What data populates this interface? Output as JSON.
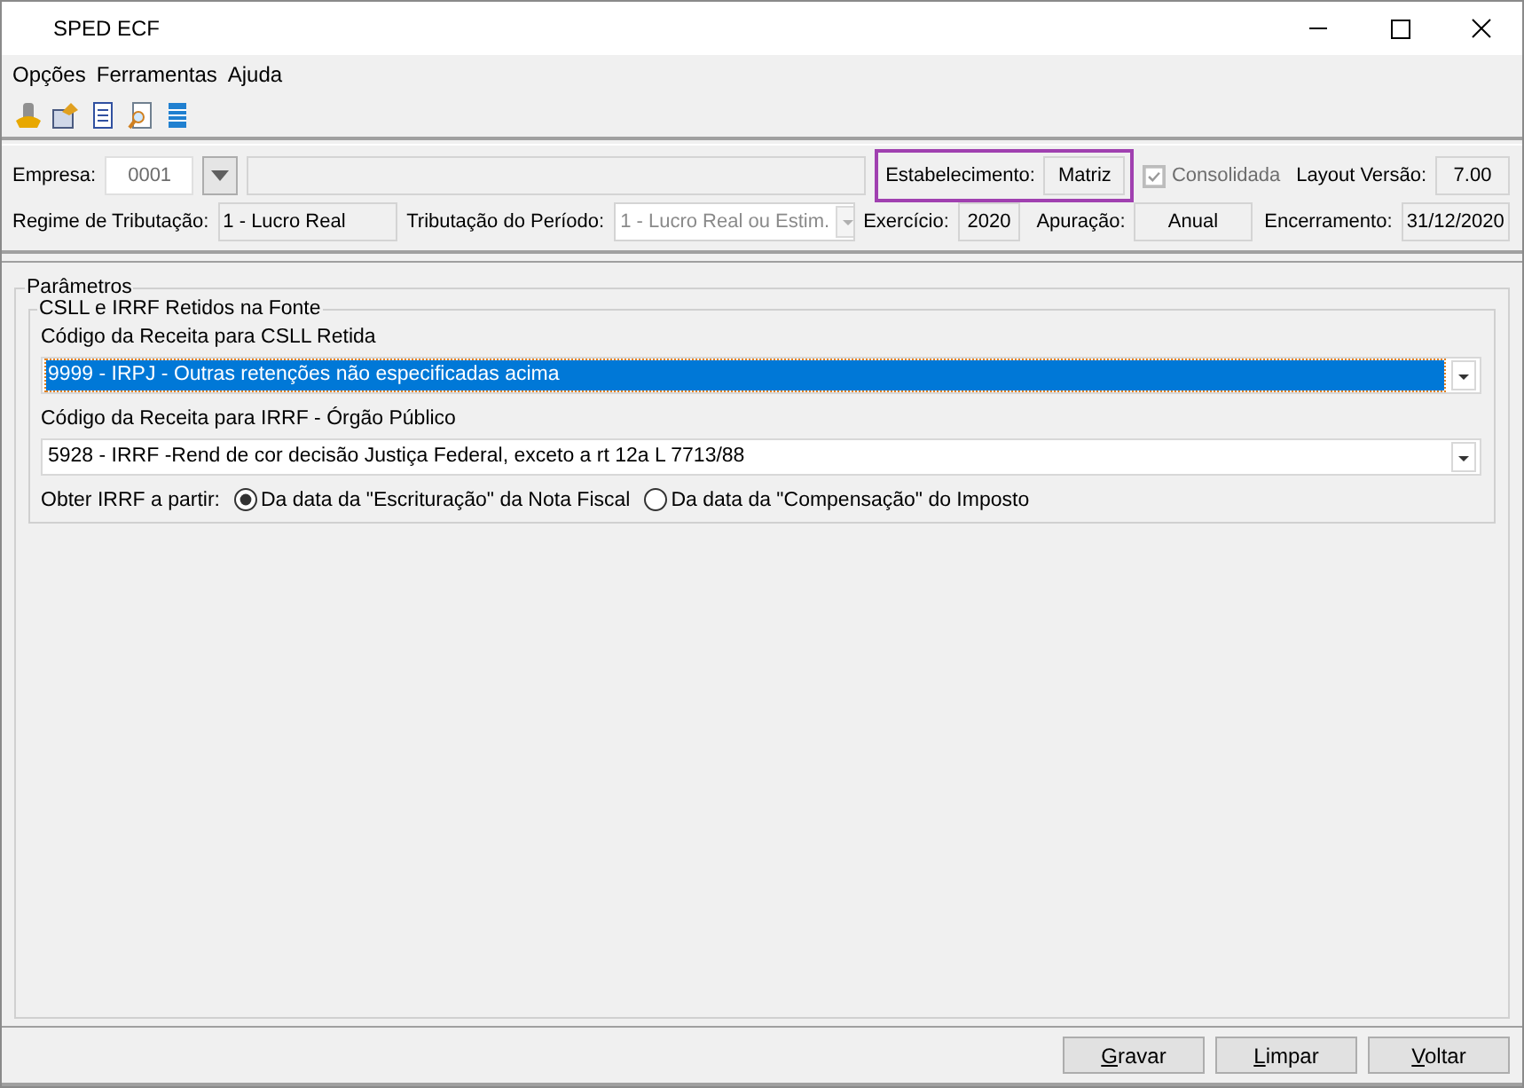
{
  "window": {
    "title": "SPED ECF"
  },
  "menu": [
    "Opções",
    "Ferramentas",
    "Ajuda"
  ],
  "header": {
    "empresa": {
      "label": "Empresa:",
      "value": "0001"
    },
    "estabelecimento": {
      "label": "Estabelecimento:",
      "value": "Matriz",
      "highlighted": true
    },
    "consolidada": {
      "label": "Consolidada",
      "checked": true,
      "disabled": true
    },
    "layout_versao": {
      "label": "Layout Versão:",
      "value": "7.00"
    },
    "regime": {
      "label": "Regime de Tributação:",
      "value": "1 - Lucro Real"
    },
    "tributacao": {
      "label": "Tributação do Período:",
      "value": "1 - Lucro Real ou Estim.",
      "disabled": true
    },
    "exercicio": {
      "label": "Exercício:",
      "value": "2020"
    },
    "apuracao": {
      "label": "Apuração:",
      "value": "Anual"
    },
    "encerramento": {
      "label": "Encerramento:",
      "value": "31/12/2020"
    }
  },
  "parametros": {
    "title": "Parâmetros",
    "group": {
      "title": "CSLL e IRRF Retidos na Fonte",
      "selects": [
        {
          "label": "Código da Receita para CSLL Retida",
          "value": "9999 - IRPJ - Outras retenções não especificadas acima",
          "focused": true
        },
        {
          "label": "Código da Receita para IRRF -  Órgão Público",
          "value": "5928 - IRRF -Rend de cor decisão Justiça Federal, exceto a rt 12a L 7713/88",
          "focused": false
        }
      ],
      "radio_group": {
        "label": "Obter IRRF a partir:",
        "options": [
          {
            "label": "Da data da \"Escrituração\" da Nota Fiscal",
            "selected": true
          },
          {
            "label": "Da data da \"Compensação\" do Imposto",
            "selected": false
          }
        ]
      }
    }
  },
  "buttons": [
    {
      "label": "Gravar",
      "underline_first": true
    },
    {
      "label": "Limpar",
      "underline_first": true
    },
    {
      "label": "Voltar",
      "underline_first": true
    }
  ]
}
